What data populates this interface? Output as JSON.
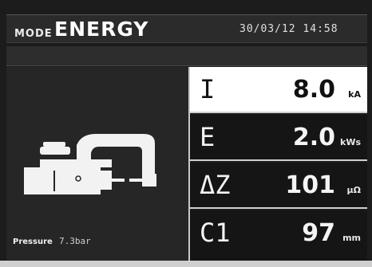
{
  "header": {
    "mode_label": "MODE",
    "mode_value": "ENERGY",
    "datetime": "30/03/12 14:58"
  },
  "left_panel": {
    "icon": "welding-clamp-icon",
    "pressure_label": "Pressure",
    "pressure_value": "7.3bar"
  },
  "readings": [
    {
      "symbol": "I",
      "value": "8.0",
      "unit": "kA",
      "highlighted": true
    },
    {
      "symbol": "E",
      "value": "2.0",
      "unit": "kWs",
      "highlighted": false
    },
    {
      "symbol": "ΔZ",
      "value": "101",
      "unit": "µΩ",
      "highlighted": false
    },
    {
      "symbol": "C1",
      "value": "97",
      "unit": "mm",
      "highlighted": false
    }
  ],
  "colors": {
    "background": "#1c1c1c",
    "highlight": "#ffffff",
    "divider": "#d0d0d0"
  }
}
